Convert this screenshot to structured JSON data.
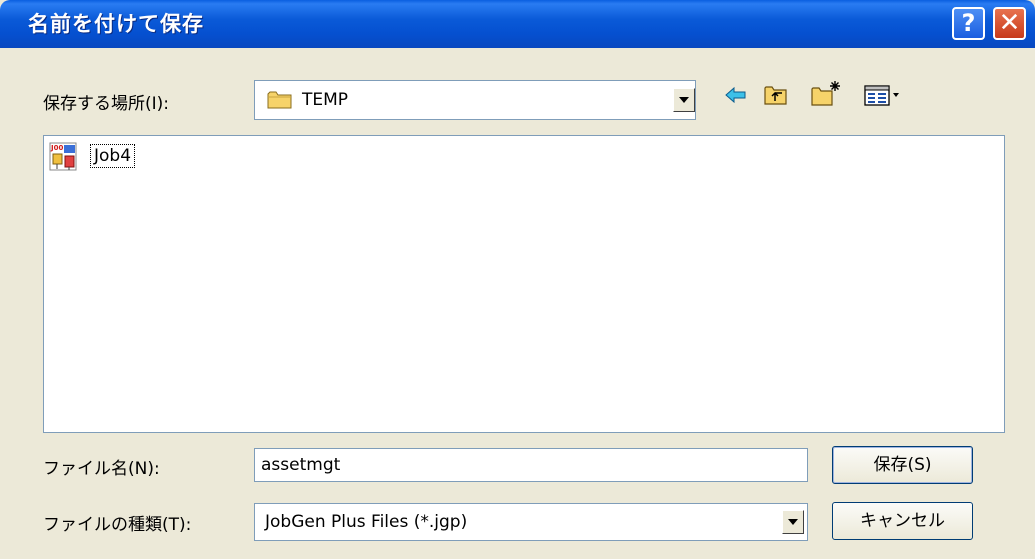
{
  "window": {
    "title": "名前を付けて保存"
  },
  "titlebar": {
    "help_glyph": "?",
    "close_glyph": "✕"
  },
  "save_in": {
    "label": "保存する場所(I):",
    "value": "TEMP",
    "folder_icon": "folder-icon"
  },
  "toolbar": {
    "icons": [
      "back-arrow-icon",
      "up-folder-icon",
      "new-folder-icon",
      "view-menu-icon"
    ]
  },
  "files": [
    {
      "name": "Job4",
      "icon": "jobgen-file-icon"
    }
  ],
  "file_name": {
    "label": "ファイル名(N):",
    "value": "assetmgt"
  },
  "file_type": {
    "label": "ファイルの種類(T):",
    "value": "JobGen Plus Files (*.jgp)"
  },
  "buttons": {
    "save": "保存(S)",
    "cancel": "キャンセル"
  },
  "colors": {
    "titlebar": "#0a5ad8",
    "dialog_bg": "#ece9d8",
    "close": "#c73a1a"
  }
}
